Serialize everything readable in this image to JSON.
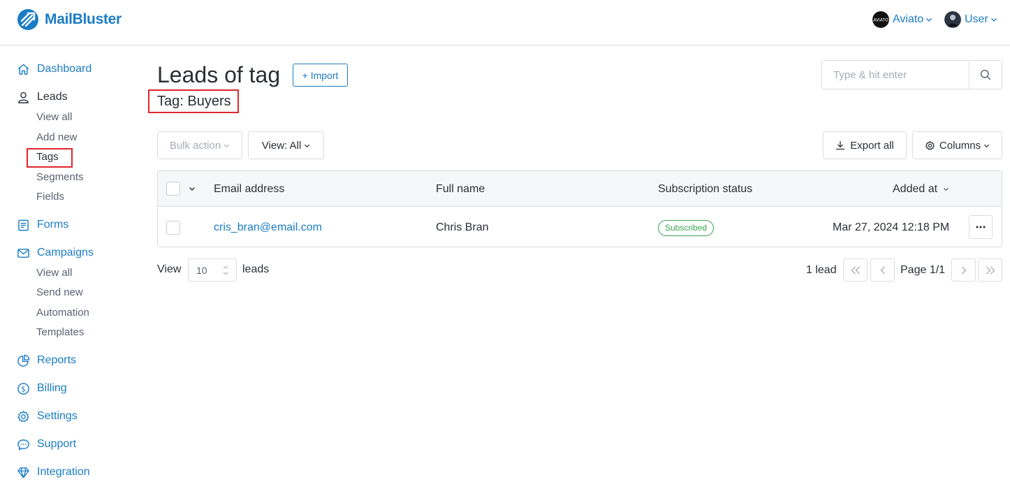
{
  "brand": {
    "name": "MailBluster",
    "color": "#1a7cc4"
  },
  "header": {
    "account": {
      "name": "Aviato",
      "icon": "aviato-logo-avatar"
    },
    "user": {
      "name": "User",
      "icon": "user-avatar"
    }
  },
  "sidebar": {
    "dashboard": "Dashboard",
    "leads": "Leads",
    "leads_sub": [
      "View all",
      "Add new",
      "Tags",
      "Segments",
      "Fields"
    ],
    "forms": "Forms",
    "campaigns": "Campaigns",
    "campaigns_sub": [
      "View all",
      "Send new",
      "Automation",
      "Templates"
    ],
    "reports": "Reports",
    "billing": "Billing",
    "settings": "Settings",
    "support": "Support",
    "integration": "Integration"
  },
  "page": {
    "title": "Leads of tag",
    "import_label": "+ Import",
    "tag_line": "Tag: Buyers"
  },
  "search": {
    "placeholder": "Type & hit enter"
  },
  "toolbar": {
    "bulk_action": "Bulk action",
    "view_filter": "View: All",
    "export_all": "Export all",
    "columns": "Columns"
  },
  "table": {
    "headers": {
      "email": "Email address",
      "name": "Full name",
      "status": "Subscription status",
      "added": "Added at"
    },
    "rows": [
      {
        "email": "cris_bran@email.com",
        "name": "Chris Bran",
        "status": "Subscribed",
        "added": "Mar 27, 2024 12:18 PM"
      }
    ]
  },
  "pagination": {
    "view_label": "View",
    "per_page": "10",
    "leads_label": "leads",
    "count": "1 lead",
    "page": "Page 1/1"
  },
  "colors": {
    "accent": "#1a7cc4",
    "highlight": "#e0262b",
    "subscribed": "#3aa650"
  }
}
